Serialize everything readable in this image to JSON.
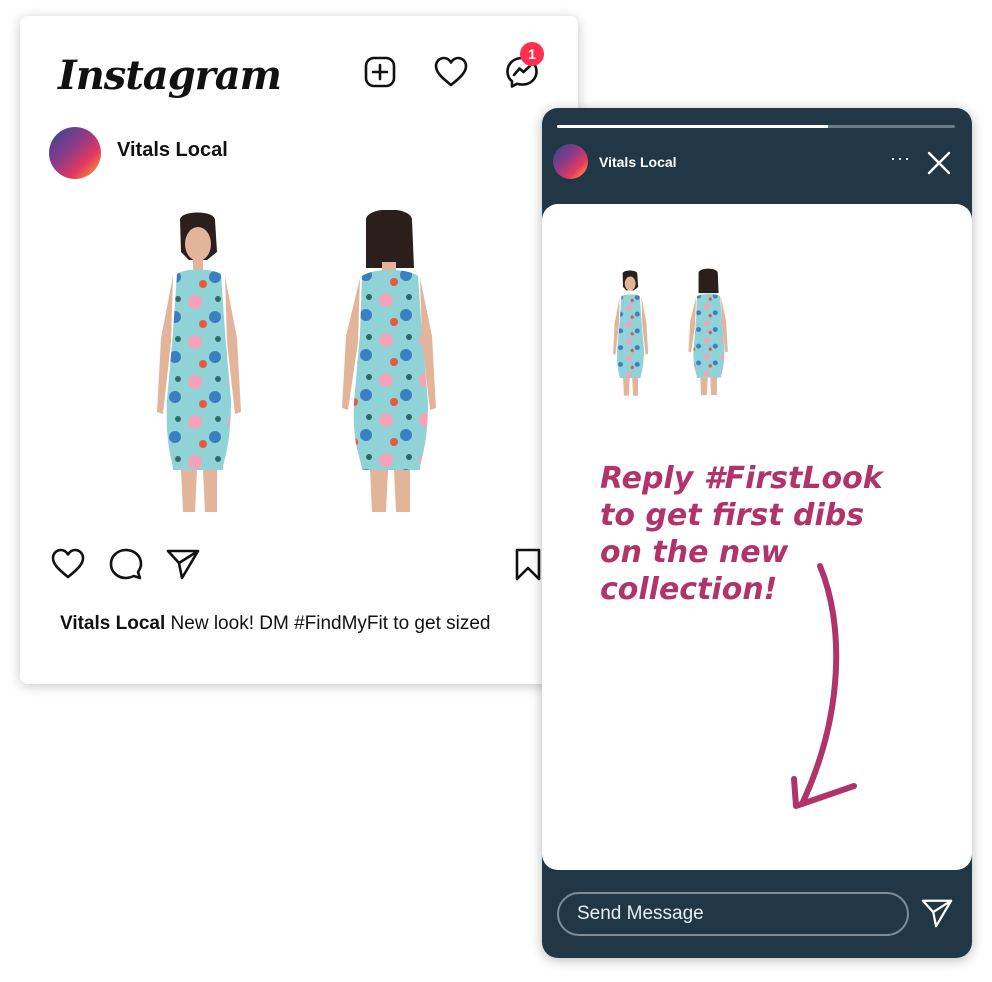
{
  "post": {
    "logo_text": "Instagram",
    "messenger_badge_count": "1",
    "author": "Vitals Local",
    "caption_user": "Vitals Local",
    "caption_text": " New look! DM #FindMyFit to get sized",
    "icons": [
      "add-post-icon",
      "heart-icon",
      "messenger-icon",
      "like-icon",
      "comment-icon",
      "share-icon",
      "bookmark-icon"
    ]
  },
  "story": {
    "author": "Vitals Local",
    "more_label": "···",
    "progress_fraction": 0.68,
    "text_lines": [
      "Reply #FirstLook",
      "to get first dibs",
      "on the new",
      "collection!"
    ],
    "message_placeholder": "Send Message",
    "accent_color": "#b0336a",
    "background_color": "#213746"
  }
}
